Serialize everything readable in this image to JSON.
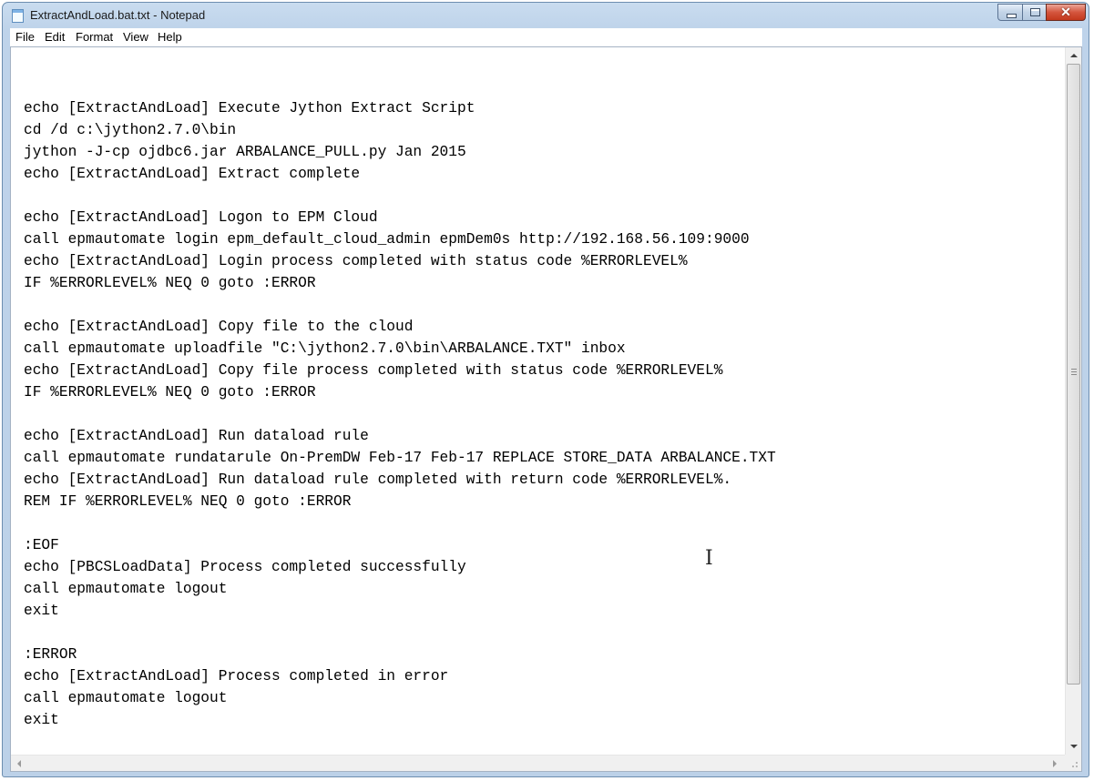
{
  "window": {
    "title": "ExtractAndLoad.bat.txt - Notepad",
    "close_glyph": "✕"
  },
  "menu": [
    "File",
    "Edit",
    "Format",
    "View",
    "Help"
  ],
  "document": {
    "lines": [
      "echo [ExtractAndLoad] Execute Jython Extract Script",
      "cd /d c:\\jython2.7.0\\bin",
      "jython -J-cp ojdbc6.jar ARBALANCE_PULL.py Jan 2015",
      "echo [ExtractAndLoad] Extract complete",
      "",
      "echo [ExtractAndLoad] Logon to EPM Cloud",
      "call epmautomate login epm_default_cloud_admin epmDem0s http://192.168.56.109:9000",
      "echo [ExtractAndLoad] Login process completed with status code %ERRORLEVEL%",
      "IF %ERRORLEVEL% NEQ 0 goto :ERROR",
      "",
      "echo [ExtractAndLoad] Copy file to the cloud",
      "call epmautomate uploadfile \"C:\\jython2.7.0\\bin\\ARBALANCE.TXT\" inbox",
      "echo [ExtractAndLoad] Copy file process completed with status code %ERRORLEVEL%",
      "IF %ERRORLEVEL% NEQ 0 goto :ERROR",
      "",
      "echo [ExtractAndLoad] Run dataload rule",
      "call epmautomate rundatarule On-PremDW Feb-17 Feb-17 REPLACE STORE_DATA ARBALANCE.TXT",
      "echo [ExtractAndLoad] Run dataload rule completed with return code %ERRORLEVEL%.",
      "REM IF %ERRORLEVEL% NEQ 0 goto :ERROR",
      "",
      ":EOF",
      "echo [PBCSLoadData] Process completed successfully",
      "call epmautomate logout",
      "exit",
      "",
      ":ERROR",
      "echo [ExtractAndLoad] Process completed in error",
      "call epmautomate logout",
      "exit"
    ]
  },
  "icons": {
    "app": "notepad-icon",
    "minimize": "minimize-icon",
    "maximize": "maximize-icon",
    "close": "close-icon",
    "cursor": "text-cursor-icon"
  },
  "colors": {
    "close_button": "#c9452a",
    "titlebar": "#c2d7ec",
    "text": "#000000"
  }
}
